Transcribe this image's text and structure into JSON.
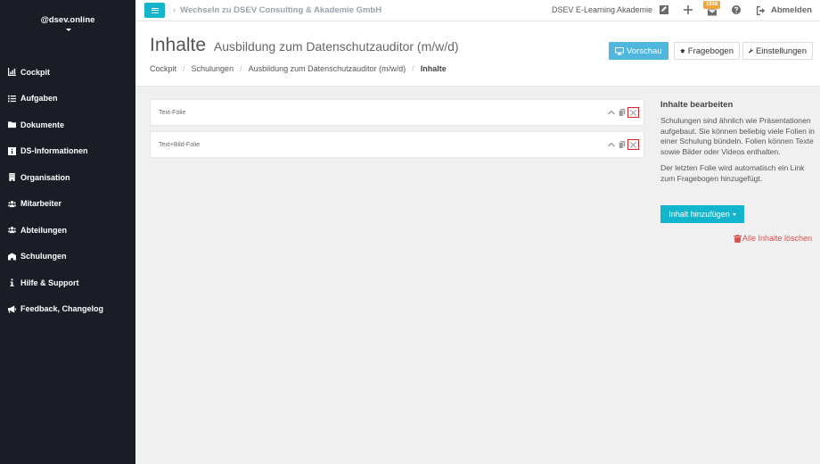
{
  "sidebar": {
    "brand": "@dsev.online",
    "items": [
      {
        "label": "Cockpit",
        "icon": "chart-icon"
      },
      {
        "label": "Aufgaben",
        "icon": "list-icon"
      },
      {
        "label": "Dokumente",
        "icon": "folder-icon"
      },
      {
        "label": "DS-Informationen",
        "icon": "info-icon"
      },
      {
        "label": "Organisation",
        "icon": "building-icon"
      },
      {
        "label": "Mitarbeiter",
        "icon": "users-icon"
      },
      {
        "label": "Abteilungen",
        "icon": "users-icon"
      },
      {
        "label": "Schulungen",
        "icon": "school-icon"
      },
      {
        "label": "Hilfe & Support",
        "icon": "info-icon"
      },
      {
        "label": "Feedback, Changelog",
        "icon": "megaphone-icon"
      }
    ]
  },
  "topbar": {
    "switch_label": "Wechseln zu DSEV Consulting & Akademie GmbH",
    "academy": "DSEV E-Learning Akademie",
    "badge_count": "1938",
    "logout_label": "Abmelden"
  },
  "header": {
    "title": "Inhalte",
    "subtitle": "Ausbildung zum Datenschutzauditor (m/w/d)",
    "breadcrumb": [
      "Cockpit",
      "Schulungen",
      "Ausbildung zum Datenschutzauditor (m/w/d)",
      "Inhalte"
    ],
    "buttons": {
      "preview": "Vorschau",
      "quiz": "Fragebogen",
      "settings": "Einstellungen"
    }
  },
  "slides": [
    {
      "label": "Text-Folie"
    },
    {
      "label": "Text+Bild-Folie"
    }
  ],
  "panel": {
    "heading": "Inhalte bearbeiten",
    "para1": "Schulungen sind ähnlich wie Präsentationen aufgebaut. Sie können beliebig viele Folien in einer Schulung bündeln. Folien können Texte sowie Bilder oder Videos enthalten.",
    "para2": "Der letzten Folie wird automatisch ein Link zum Fragebogen hinzugefügt.",
    "add_button": "Inhalt hinzufügen",
    "delete_all": "Alle Inhalte löschen"
  },
  "colors": {
    "sidebar_bg": "#1a1d26",
    "accent": "#12b5cb",
    "preview_button": "#4fb7dd",
    "danger": "#d9534f",
    "badge": "#f0a63a"
  }
}
